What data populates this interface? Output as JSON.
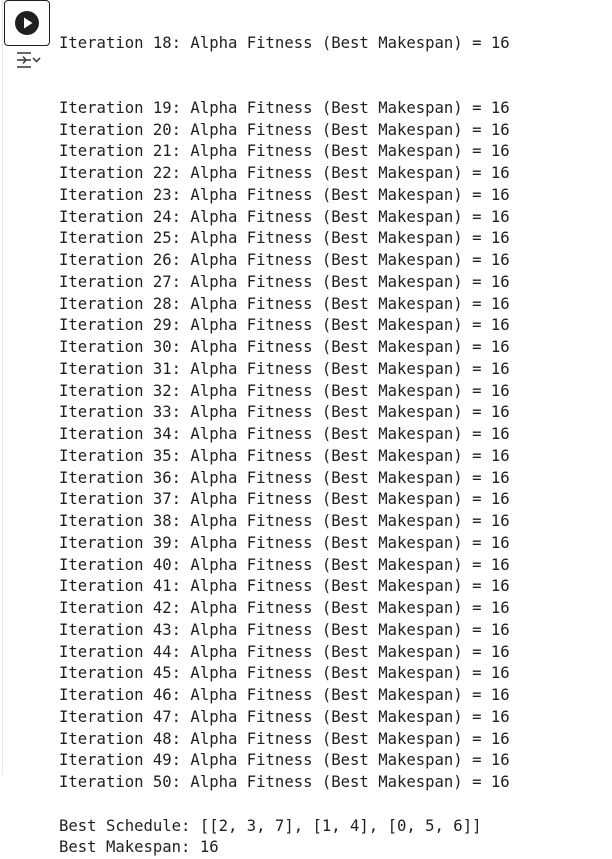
{
  "output": {
    "partial_line": "Iteration 18: Alpha Fitness (Best Makespan) = 16",
    "lines": [
      "Iteration 19: Alpha Fitness (Best Makespan) = 16",
      "Iteration 20: Alpha Fitness (Best Makespan) = 16",
      "Iteration 21: Alpha Fitness (Best Makespan) = 16",
      "Iteration 22: Alpha Fitness (Best Makespan) = 16",
      "Iteration 23: Alpha Fitness (Best Makespan) = 16",
      "Iteration 24: Alpha Fitness (Best Makespan) = 16",
      "Iteration 25: Alpha Fitness (Best Makespan) = 16",
      "Iteration 26: Alpha Fitness (Best Makespan) = 16",
      "Iteration 27: Alpha Fitness (Best Makespan) = 16",
      "Iteration 28: Alpha Fitness (Best Makespan) = 16",
      "Iteration 29: Alpha Fitness (Best Makespan) = 16",
      "Iteration 30: Alpha Fitness (Best Makespan) = 16",
      "Iteration 31: Alpha Fitness (Best Makespan) = 16",
      "Iteration 32: Alpha Fitness (Best Makespan) = 16",
      "Iteration 33: Alpha Fitness (Best Makespan) = 16",
      "Iteration 34: Alpha Fitness (Best Makespan) = 16",
      "Iteration 35: Alpha Fitness (Best Makespan) = 16",
      "Iteration 36: Alpha Fitness (Best Makespan) = 16",
      "Iteration 37: Alpha Fitness (Best Makespan) = 16",
      "Iteration 38: Alpha Fitness (Best Makespan) = 16",
      "Iteration 39: Alpha Fitness (Best Makespan) = 16",
      "Iteration 40: Alpha Fitness (Best Makespan) = 16",
      "Iteration 41: Alpha Fitness (Best Makespan) = 16",
      "Iteration 42: Alpha Fitness (Best Makespan) = 16",
      "Iteration 43: Alpha Fitness (Best Makespan) = 16",
      "Iteration 44: Alpha Fitness (Best Makespan) = 16",
      "Iteration 45: Alpha Fitness (Best Makespan) = 16",
      "Iteration 46: Alpha Fitness (Best Makespan) = 16",
      "Iteration 47: Alpha Fitness (Best Makespan) = 16",
      "Iteration 48: Alpha Fitness (Best Makespan) = 16",
      "Iteration 49: Alpha Fitness (Best Makespan) = 16",
      "Iteration 50: Alpha Fitness (Best Makespan) = 16"
    ],
    "best_schedule": "Best Schedule: [[2, 3, 7], [1, 4], [0, 5, 6]]",
    "best_makespan": "Best Makespan: 16"
  },
  "icons": {
    "run": "play-circle-icon",
    "output_toggle": "output-actions-icon"
  }
}
